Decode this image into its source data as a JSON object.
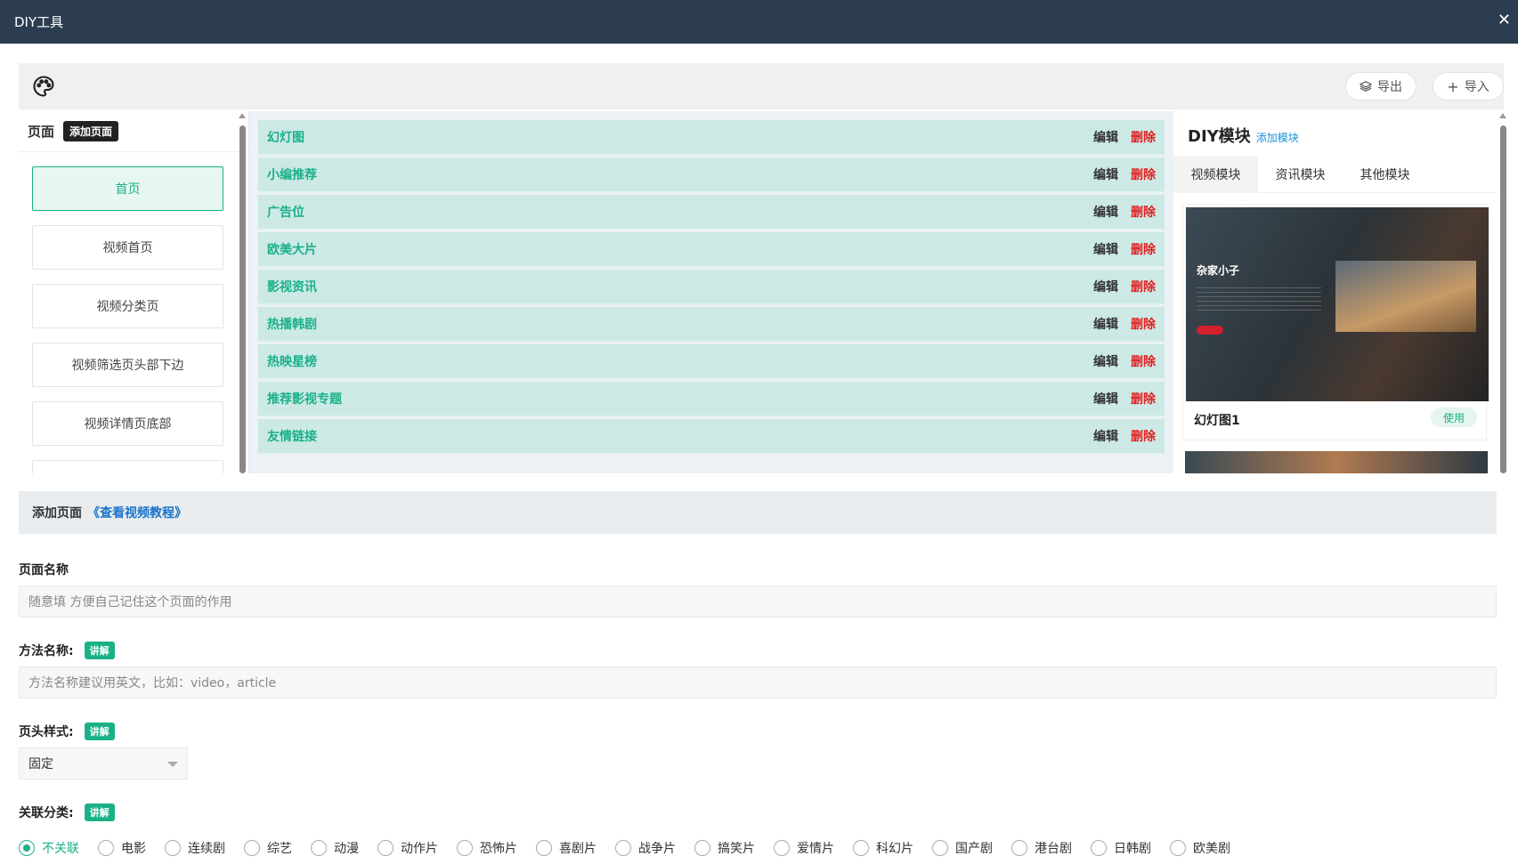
{
  "window": {
    "title": "DIY工具",
    "close": "✕"
  },
  "toolbar": {
    "export_label": "导出",
    "import_label": "导入"
  },
  "pages": {
    "heading": "页面",
    "add_label": "添加页面",
    "items": [
      "首页",
      "视频首页",
      "视频分类页",
      "视频筛选页头部下边",
      "视频详情页底部"
    ]
  },
  "modules": {
    "edit_label": "编辑",
    "delete_label": "删除",
    "rows": [
      "幻灯图",
      "小编推荐",
      "广告位",
      "欧美大片",
      "影视资讯",
      "热播韩剧",
      "热映星榜",
      "推荐影视专题",
      "友情链接"
    ]
  },
  "diy": {
    "title": "DIY模块",
    "add_label": "添加模块",
    "tabs": [
      "视频模块",
      "资讯模块",
      "其他模块"
    ],
    "card": {
      "thumb_title": "杂家小子",
      "name": "幻灯图1",
      "use_label": "使用"
    }
  },
  "form": {
    "heading": "添加页面",
    "tutorial_link": "《查看视频教程》",
    "page_name_label": "页面名称",
    "page_name_placeholder": "随意填 方便自己记住这个页面的作用",
    "method_label": "方法名称:",
    "method_placeholder": "方法名称建议用英文，比如：video，article",
    "explain_tag": "讲解",
    "header_style_label": "页头样式:",
    "header_style_value": "固定",
    "category_label": "关联分类:",
    "categories": [
      "不关联",
      "电影",
      "连续剧",
      "综艺",
      "动漫",
      "动作片",
      "恐怖片",
      "喜剧片",
      "战争片",
      "搞笑片",
      "爱情片",
      "科幻片",
      "国产剧",
      "港台剧",
      "日韩剧",
      "欧美剧"
    ],
    "selected_category": "不关联"
  },
  "colors": {
    "accent": "#19b187",
    "danger": "#e02020",
    "titlebar": "#2c3d51",
    "link": "#1a73c8"
  }
}
